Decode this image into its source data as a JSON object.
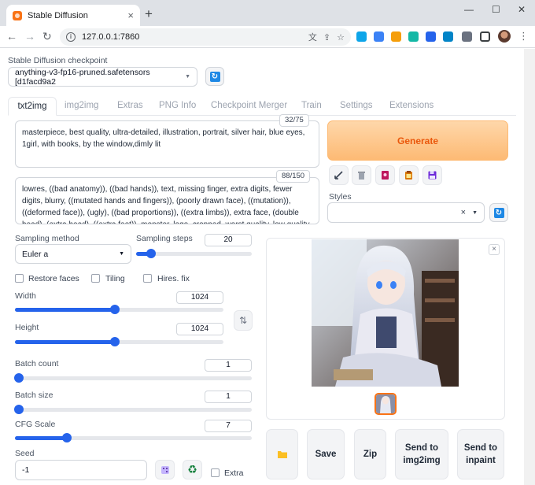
{
  "browser": {
    "tab_title": "Stable Diffusion",
    "tab_close": "×",
    "new_tab": "+",
    "url": "127.0.0.1:7860",
    "win_min": "—",
    "win_max": "☐",
    "win_close": "✕"
  },
  "checkpoint": {
    "label": "Stable Diffusion checkpoint",
    "value": "anything-v3-fp16-pruned.safetensors [d1facd9a2"
  },
  "tabs": [
    "txt2img",
    "img2img",
    "Extras",
    "PNG Info",
    "Checkpoint Merger",
    "Train",
    "Settings",
    "Extensions"
  ],
  "prompt": {
    "text": "masterpiece, best quality, ultra-detailed, illustration, portrait, silver hair, blue eyes, 1girl, with books,  by the window,dimly lit",
    "counter": "32/75"
  },
  "negative_prompt": {
    "text": "lowres, ((bad anatomy)), ((bad hands)), text, missing finger, extra digits, fewer digits, blurry, ((mutated hands and fingers)), (poorly drawn face), ((mutation)), ((deformed face)), (ugly), ((bad proportions)), ((extra limbs)), extra face, (double head), (extra head), ((extra feet)), monster, logo, cropped, worst quality, low quality, normal quality, jpeg",
    "counter": "88/150"
  },
  "generate_label": "Generate",
  "styles_label": "Styles",
  "styles_clear": "×",
  "sampling": {
    "method_label": "Sampling method",
    "method_value": "Euler a",
    "steps_label": "Sampling steps",
    "steps_value": "20",
    "steps_fraction": 0.13
  },
  "options": {
    "restore_faces": "Restore faces",
    "tiling": "Tiling",
    "hires_fix": "Hires. fix"
  },
  "width": {
    "label": "Width",
    "value": "1024",
    "fraction": 0.48
  },
  "height": {
    "label": "Height",
    "value": "1024",
    "fraction": 0.48
  },
  "batch_count": {
    "label": "Batch count",
    "value": "1",
    "fraction": 0.0
  },
  "batch_size": {
    "label": "Batch size",
    "value": "1",
    "fraction": 0.0
  },
  "cfg": {
    "label": "CFG Scale",
    "value": "7",
    "fraction": 0.22
  },
  "seed": {
    "label": "Seed",
    "value": "-1",
    "extra_label": "Extra"
  },
  "output_buttons": {
    "save": "Save",
    "zip": "Zip",
    "send_img2img": "Send to img2img",
    "send_inpaint": "Send to inpaint"
  },
  "gallery_close": "×",
  "colors": {
    "accent": "#2563eb",
    "generate": "#fdba74",
    "generate_text": "#ea580c"
  }
}
